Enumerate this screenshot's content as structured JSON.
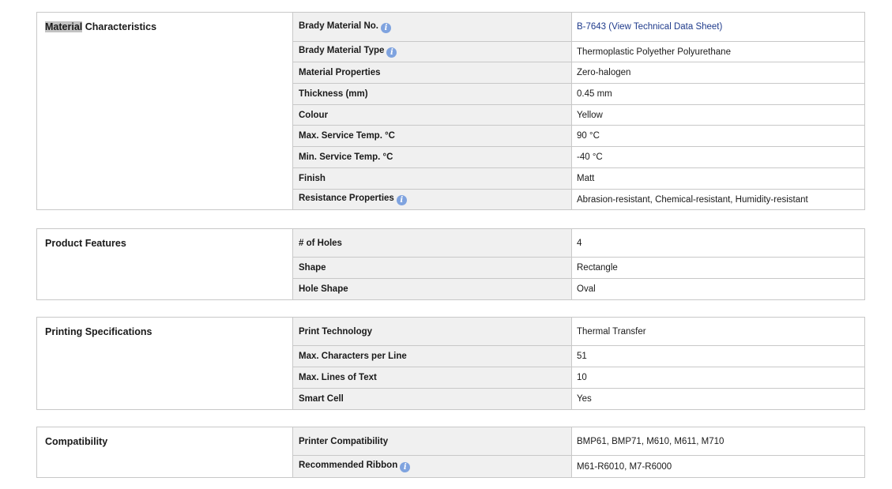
{
  "material": {
    "title_highlight": "Material",
    "title_rest": " Characteristics",
    "rows": [
      {
        "label": "Brady Material No.",
        "value": "B-7643 (View Technical Data Sheet)"
      },
      {
        "label": "Brady Material Type",
        "value": "Thermoplastic Polyether Polyurethane"
      },
      {
        "label": "Material Properties",
        "value": "Zero-halogen"
      },
      {
        "label": "Thickness (mm)",
        "value": "0.45 mm"
      },
      {
        "label": "Colour",
        "value": "Yellow"
      },
      {
        "label": "Max. Service Temp. °C",
        "value": "90 °C"
      },
      {
        "label": "Min. Service Temp. °C",
        "value": "-40 °C"
      },
      {
        "label": "Finish",
        "value": "Matt"
      },
      {
        "label": "Resistance Properties",
        "value": "Abrasion-resistant, Chemical-resistant, Humidity-resistant"
      }
    ]
  },
  "features": {
    "title": "Product Features",
    "rows": [
      {
        "label": "# of Holes",
        "value": "4"
      },
      {
        "label": "Shape",
        "value": "Rectangle"
      },
      {
        "label": "Hole Shape",
        "value": "Oval"
      }
    ]
  },
  "printing": {
    "title": "Printing Specifications",
    "rows": [
      {
        "label": "Print Technology",
        "value": "Thermal Transfer"
      },
      {
        "label": "Max. Characters per Line",
        "value": "51"
      },
      {
        "label": "Max. Lines of Text",
        "value": "10"
      },
      {
        "label": "Smart Cell",
        "value": "Yes"
      }
    ]
  },
  "compatibility": {
    "title": "Compatibility",
    "rows": [
      {
        "label": "Printer Compatibility",
        "value": "BMP61, BMP71, M610, M611, M710"
      },
      {
        "label": "Recommended Ribbon",
        "value": "M61-R6010, M7-R6000"
      }
    ]
  },
  "info_icon_glyph": "i",
  "colors": {
    "link": "#1f3b8c",
    "info_icon": "#7fa3df",
    "label_bg": "#f0f0f0",
    "border": "#c8c8c8"
  }
}
